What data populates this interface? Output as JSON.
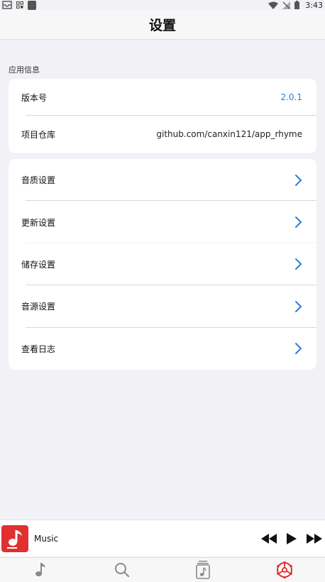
{
  "status_bar": {
    "time": "3:43",
    "icons": [
      "inbox-icon",
      "grid-icon",
      "square-icon",
      "wifi-icon",
      "signal-off-icon",
      "battery-icon"
    ]
  },
  "header": {
    "title": "设置"
  },
  "app_info": {
    "section_title": "应用信息",
    "rows": [
      {
        "label": "版本号",
        "value": "2.0.1"
      },
      {
        "label": "项目仓库",
        "value": "github.com/canxin121/app_rhyme"
      }
    ]
  },
  "settings": {
    "rows": [
      {
        "label": "音质设置"
      },
      {
        "label": "更新设置"
      },
      {
        "label": "储存设置"
      },
      {
        "label": "音源设置"
      },
      {
        "label": "查看日志"
      }
    ]
  },
  "player": {
    "title": "Music",
    "controls": [
      "previous-icon",
      "play-icon",
      "next-icon"
    ]
  },
  "tab_bar": {
    "tabs": [
      "music-note-icon",
      "search-icon",
      "library-icon",
      "settings-icon"
    ],
    "active": "settings-icon"
  },
  "colors": {
    "accent_blue": "#2b7fd6",
    "active_tab_red": "#e03030",
    "background": "#f2f1f6"
  }
}
